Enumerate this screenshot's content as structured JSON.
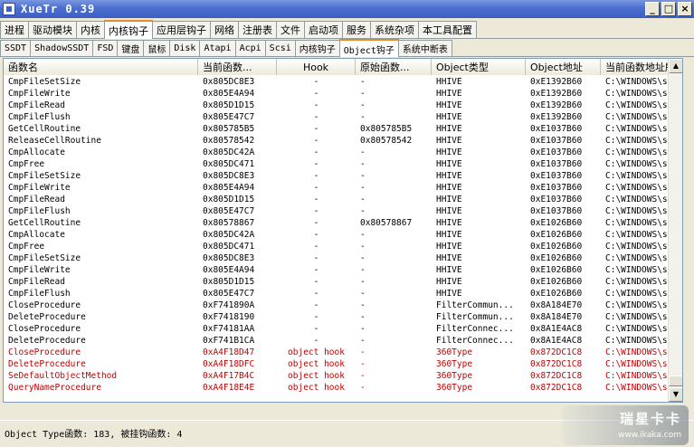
{
  "window": {
    "title": "XueTr 0.39"
  },
  "main_tabs": [
    "进程",
    "驱动模块",
    "内核",
    "内核钩子",
    "应用层钩子",
    "网络",
    "注册表",
    "文件",
    "启动项",
    "服务",
    "系统杂项",
    "本工具配置"
  ],
  "main_tab_active": 3,
  "sub_tabs": [
    "SSDT",
    "ShadowSSDT",
    "FSD",
    "键盘",
    "鼠标",
    "Disk",
    "Atapi",
    "Acpi",
    "Scsi",
    "内核钩子",
    "Object钩子",
    "系统中断表"
  ],
  "sub_tab_active": 10,
  "columns": [
    "函数名",
    "当前函数...",
    "Hook",
    "原始函数...",
    "Object类型",
    "Object地址",
    "当前函数地址所"
  ],
  "rows": [
    [
      "CmpFileSetSize",
      "0x805DC8E3",
      "-",
      "-",
      "HHIVE",
      "0xE1392B60",
      "C:\\WINDOWS\\sys"
    ],
    [
      "CmpFileWrite",
      "0x805E4A94",
      "-",
      "-",
      "HHIVE",
      "0xE1392B60",
      "C:\\WINDOWS\\sys"
    ],
    [
      "CmpFileRead",
      "0x805D1D15",
      "-",
      "-",
      "HHIVE",
      "0xE1392B60",
      "C:\\WINDOWS\\sys"
    ],
    [
      "CmpFileFlush",
      "0x805E47C7",
      "-",
      "-",
      "HHIVE",
      "0xE1392B60",
      "C:\\WINDOWS\\sys"
    ],
    [
      "GetCellRoutine",
      "0x805785B5",
      "-",
      "0x805785B5",
      "HHIVE",
      "0xE1037B60",
      "C:\\WINDOWS\\sys"
    ],
    [
      "ReleaseCellRoutine",
      "0x80578542",
      "-",
      "0x80578542",
      "HHIVE",
      "0xE1037B60",
      "C:\\WINDOWS\\sys"
    ],
    [
      "CmpAllocate",
      "0x805DC42A",
      "-",
      "-",
      "HHIVE",
      "0xE1037B60",
      "C:\\WINDOWS\\sys"
    ],
    [
      "CmpFree",
      "0x805DC471",
      "-",
      "-",
      "HHIVE",
      "0xE1037B60",
      "C:\\WINDOWS\\sys"
    ],
    [
      "CmpFileSetSize",
      "0x805DC8E3",
      "-",
      "-",
      "HHIVE",
      "0xE1037B60",
      "C:\\WINDOWS\\sys"
    ],
    [
      "CmpFileWrite",
      "0x805E4A94",
      "-",
      "-",
      "HHIVE",
      "0xE1037B60",
      "C:\\WINDOWS\\sys"
    ],
    [
      "CmpFileRead",
      "0x805D1D15",
      "-",
      "-",
      "HHIVE",
      "0xE1037B60",
      "C:\\WINDOWS\\sys"
    ],
    [
      "CmpFileFlush",
      "0x805E47C7",
      "-",
      "-",
      "HHIVE",
      "0xE1037B60",
      "C:\\WINDOWS\\sys"
    ],
    [
      "GetCellRoutine",
      "0x80578867",
      "-",
      "0x80578867",
      "HHIVE",
      "0xE1026B60",
      "C:\\WINDOWS\\sys"
    ],
    [
      "CmpAllocate",
      "0x805DC42A",
      "-",
      "-",
      "HHIVE",
      "0xE1026B60",
      "C:\\WINDOWS\\sys"
    ],
    [
      "CmpFree",
      "0x805DC471",
      "-",
      "-",
      "HHIVE",
      "0xE1026B60",
      "C:\\WINDOWS\\sys"
    ],
    [
      "CmpFileSetSize",
      "0x805DC8E3",
      "-",
      "-",
      "HHIVE",
      "0xE1026B60",
      "C:\\WINDOWS\\sys"
    ],
    [
      "CmpFileWrite",
      "0x805E4A94",
      "-",
      "-",
      "HHIVE",
      "0xE1026B60",
      "C:\\WINDOWS\\sys"
    ],
    [
      "CmpFileRead",
      "0x805D1D15",
      "-",
      "-",
      "HHIVE",
      "0xE1026B60",
      "C:\\WINDOWS\\sys"
    ],
    [
      "CmpFileFlush",
      "0x805E47C7",
      "-",
      "-",
      "HHIVE",
      "0xE1026B60",
      "C:\\WINDOWS\\sys"
    ],
    [
      "CloseProcedure",
      "0xF741890A",
      "-",
      "-",
      "FilterCommun...",
      "0x8A184E70",
      "C:\\WINDOWS\\sys"
    ],
    [
      "DeleteProcedure",
      "0xF7418190",
      "-",
      "-",
      "FilterCommun...",
      "0x8A184E70",
      "C:\\WINDOWS\\sys"
    ],
    [
      "CloseProcedure",
      "0xF74181AA",
      "-",
      "-",
      "FilterConnec...",
      "0x8A1E4AC8",
      "C:\\WINDOWS\\sys"
    ],
    [
      "DeleteProcedure",
      "0xF741B1CA",
      "-",
      "-",
      "FilterConnec...",
      "0x8A1E4AC8",
      "C:\\WINDOWS\\sys"
    ],
    [
      "CloseProcedure",
      "0xA4F18D47",
      "object hook",
      "-",
      "360Type",
      "0x872DC1C8",
      "C:\\WINDOWS\\sys"
    ],
    [
      "DeleteProcedure",
      "0xA4F18DFC",
      "object hook",
      "-",
      "360Type",
      "0x872DC1C8",
      "C:\\WINDOWS\\sys"
    ],
    [
      "SeDefaultObjectMethod",
      "0xA4F17B4C",
      "object hook",
      "-",
      "360Type",
      "0x872DC1C8",
      "C:\\WINDOWS\\sys"
    ],
    [
      "QueryNameProcedure",
      "0xA4F18E4E",
      "object hook",
      "-",
      "360Type",
      "0x872DC1C8",
      "C:\\WINDOWS\\sys"
    ]
  ],
  "hooked_color": "#c00000",
  "status": {
    "text": "Object Type函数: 183, 被挂钩函数: 4"
  },
  "watermark": {
    "cn": "瑞星卡卡",
    "en": "www.ikaka.com"
  }
}
